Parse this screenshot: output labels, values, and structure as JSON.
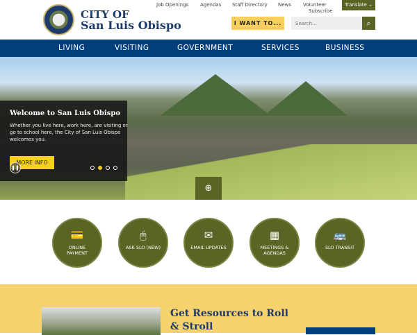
{
  "header": {
    "logo_line1": "City of",
    "logo_line2": "San Luis Obispo",
    "util_links": [
      "Job Openings",
      "Agendas",
      "Staff Directory",
      "News",
      "Volunteer",
      "Subscribe"
    ],
    "translate": "Translate ⌄",
    "i_want": "I WANT TO...",
    "search_placeholder": "Search...",
    "search_icon": "⌕"
  },
  "nav": [
    "LIVING",
    "VISITING",
    "GOVERNMENT",
    "SERVICES",
    "BUSINESS"
  ],
  "hero": {
    "title": "Welcome to San Luis Obispo",
    "text": "Whether you live here, work here, are visiting or go to school here, the City of San Luis Obispo welcomes you.",
    "button": "MORE INFO",
    "active_slide": 2,
    "slide_count": 4
  },
  "quick_links": [
    {
      "label": "ONLINE PAYMENT",
      "icon": "💳"
    },
    {
      "label": "ASK SLO (NEW)",
      "icon": "🖱"
    },
    {
      "label": "EMAIL UPDATES",
      "icon": "✉"
    },
    {
      "label": "MEETINGS & AGENDAS",
      "icon": "▦"
    },
    {
      "label": "SLO TRANSIT",
      "icon": "🚌"
    }
  ],
  "feature": {
    "title": "Get Resources to Roll & Stroll"
  },
  "colors": {
    "navy": "#033f7d",
    "olive": "#5a6424",
    "gold": "#f7cf5f"
  }
}
